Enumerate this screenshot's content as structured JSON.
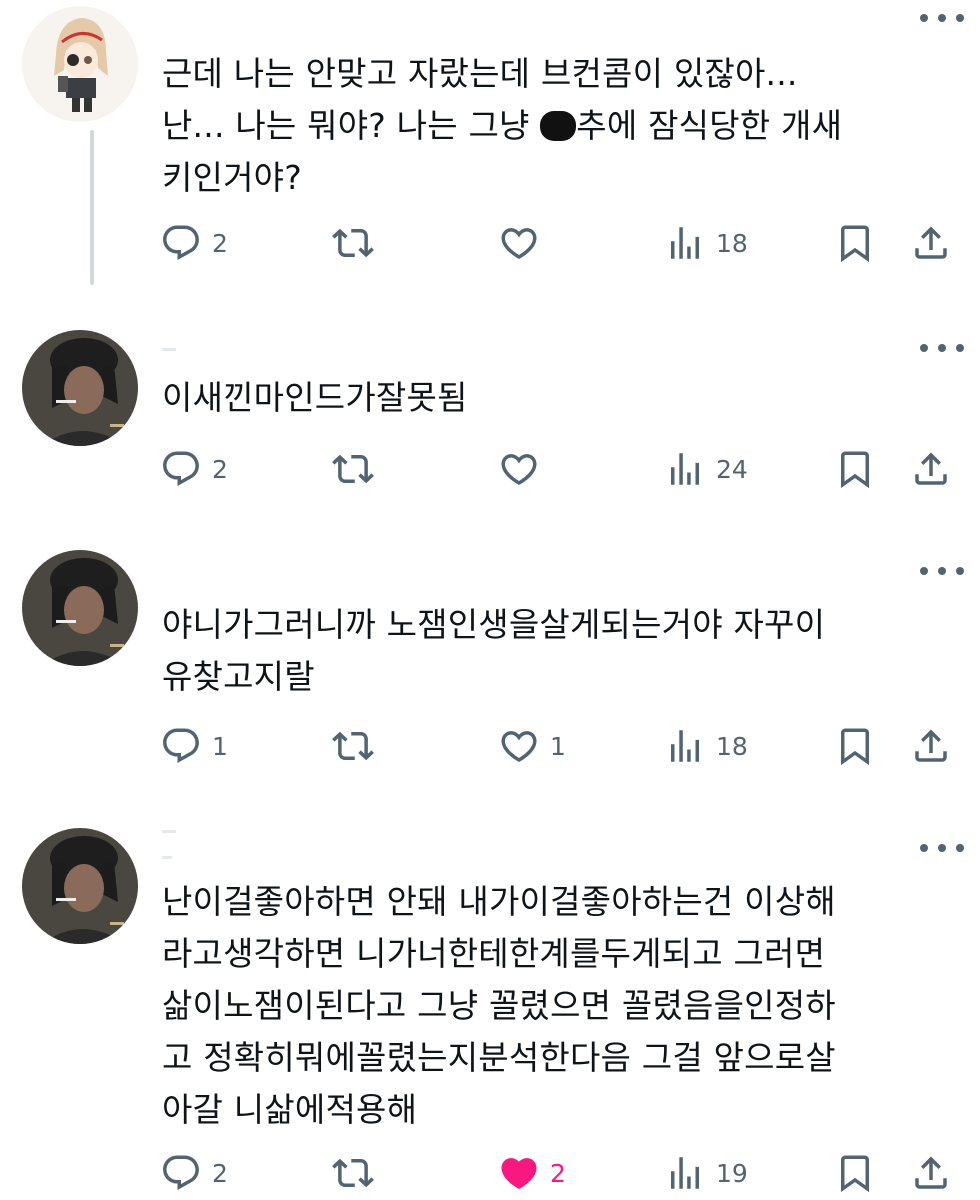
{
  "colors": {
    "text": "#0f1419",
    "secondary": "#536471",
    "thread_line": "#cfd9de",
    "like_active": "#f91880"
  },
  "tweets": [
    {
      "avatar": "anime-character-avatar",
      "text_parts": [
        "근데 나는 안맞고 자랐는데 브컨콤이 있잖아...\n난... 나는 뭐야? 나는 그냥 ",
        "추에 잠식당한 개새\n키인거야?"
      ],
      "has_redaction": true,
      "reply_count": "2",
      "retweet_count": "",
      "like_count": "",
      "liked": false,
      "view_count": "18"
    },
    {
      "avatar": "soldier-photo-avatar",
      "text": "이새낀마인드가잘못됨",
      "reply_count": "2",
      "retweet_count": "",
      "like_count": "",
      "liked": false,
      "view_count": "24"
    },
    {
      "avatar": "soldier-photo-avatar",
      "text": "야니가그러니까 노잼인생을살게되는거야 자꾸이\n유찾고지랄",
      "reply_count": "1",
      "retweet_count": "",
      "like_count": "1",
      "liked": false,
      "view_count": "18"
    },
    {
      "avatar": "soldier-photo-avatar",
      "text": "난이걸좋아하면 안돼 내가이걸좋아하는건 이상해\n라고생각하면 니가너한테한계를두게되고 그러면\n삶이노잼이된다고 그냥 꼴렸으면 꼴렸음을인정하\n고 정확히뭐에꼴렸는지분석한다음 그걸 앞으로살\n아갈 니삶에적용해",
      "reply_count": "2",
      "retweet_count": "",
      "like_count": "2",
      "liked": true,
      "view_count": "19"
    }
  ],
  "icons": {
    "reply": "reply-icon",
    "retweet": "retweet-icon",
    "like": "heart-icon",
    "views": "views-chart-icon",
    "bookmark": "bookmark-icon",
    "share": "share-icon",
    "more": "more-options-icon"
  }
}
